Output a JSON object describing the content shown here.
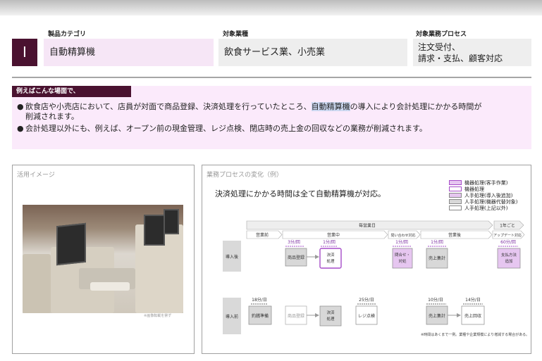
{
  "header": {
    "category_label": "製品カテゴリ",
    "category_number": "I",
    "category_value": "自動精算機",
    "industry_label": "対象業種",
    "industry_value": "飲食サービス業、小売業",
    "process_label": "対象業務プロセス",
    "process_value_line1": "注文受付、",
    "process_value_line2": "請求・支払、顧客対応"
  },
  "example": {
    "tab_label": "例えばこんな場面で、",
    "bullet1_line1_pre": "飲食店や小売店において、店員が対面で商品登録、決済処理を行っていたところ、",
    "bullet1_line1_highlight": "自動精算機",
    "bullet1_line1_post": "の導入により会計処理にかかる時間が",
    "bullet1_line2": "削減されます。",
    "bullet2": "会計処理以外にも、例えば、オープン前の現金管理、レジ点検、閉店時の売上金の回収などの業務が削減されます。",
    "bullet_symbol": "●"
  },
  "usage_panel": {
    "title": "活用イメージ",
    "photo_caption": "※画像転載を禁ず"
  },
  "process_panel": {
    "title": "業務プロセスの変化（例）",
    "caption": "決済処理にかかる時間は全て自動精算機が対応。",
    "legend": [
      {
        "label": "機器処理(客手作業)",
        "color": "#e6c6f0",
        "border": "#a64cc8"
      },
      {
        "label": "機器処理",
        "color": "#ffffff",
        "border": "#a64cc8"
      },
      {
        "label": "人手処理(導入後追加)",
        "color": "#e6c6f0",
        "border": "#888888"
      },
      {
        "label": "人手処理(機器代替対象)",
        "color": "#d8d8d8",
        "border": "#888888"
      },
      {
        "label": "人手処理(上記以外)",
        "color": "#ffffff",
        "border": "#888888"
      }
    ],
    "timeline": {
      "business_day": "毎営業日",
      "yearly": "1年ごと",
      "phases": [
        "営業前",
        "営業中",
        "問い合わせ対応",
        "営業後",
        "アップデート対応"
      ]
    },
    "row_after": {
      "label": "導入後",
      "boxes": [
        {
          "text": "商品登録",
          "time": "3分/回"
        },
        {
          "text": "決済処理",
          "time": "1分/回"
        },
        {
          "text": "問合せ対処",
          "time": "1分/回"
        },
        {
          "text": "売上集計",
          "time": "1分/回"
        },
        {
          "text": "支払方法追加",
          "time": "60分/回"
        }
      ]
    },
    "row_before": {
      "label": "導入前",
      "boxes": [
        {
          "text": "釣銭準備",
          "time": "18分/日"
        },
        {
          "text": "商品登録",
          "time": ""
        },
        {
          "text": "決済処理",
          "time": ""
        },
        {
          "text": "レジ点検",
          "time": "25分/日"
        },
        {
          "text": "売上集計",
          "time": "10分/日"
        },
        {
          "text": "売上回収",
          "time": "14分/日"
        }
      ]
    },
    "note": "※時間はあくまで一例。業種や企業規模により増減する場合がある。"
  }
}
